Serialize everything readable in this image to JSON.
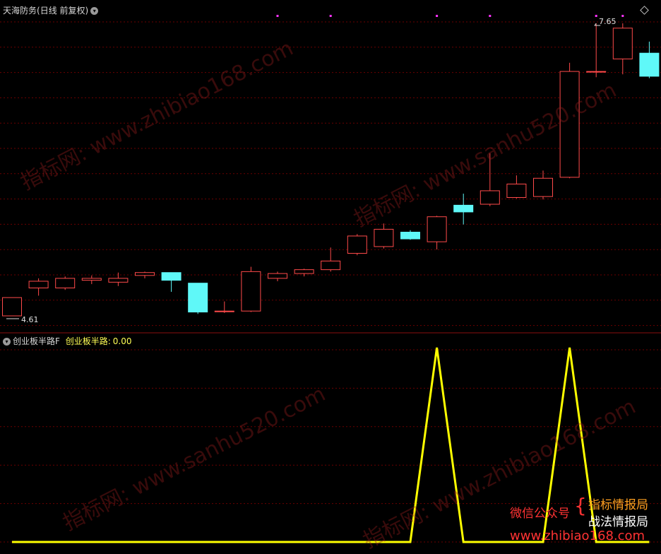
{
  "upper_panel": {
    "title": "天海防务",
    "period": "(日线 前复权)",
    "price_high_label": "7.65",
    "price_low_label": "4.61"
  },
  "lower_panel": {
    "indicator_name": "创业板半路F",
    "indicator_label": "创业板半路:",
    "indicator_value": "0.00"
  },
  "watermarks": {
    "site1": "指标网: www.zhibiao168.com",
    "site2": "指标网: www.sanhu520.com"
  },
  "brand": {
    "wechat": "微信公众号",
    "line1": "指标情报局",
    "line2": "战法情报局",
    "url": "www.zhibiao168.com"
  },
  "colors": {
    "up": "#ff4a4a",
    "down": "#5ff8f8",
    "grid": "#6b0000",
    "indicator": "#ffff00",
    "marker": "#ff33ff"
  },
  "chart_data": [
    {
      "type": "candlestick",
      "title": "天海防务",
      "y_marks": {
        "high": 7.65,
        "low": 4.61
      },
      "candles": [
        {
          "o": 4.61,
          "h": 4.8,
          "l": 4.61,
          "c": 4.8
        },
        {
          "o": 4.9,
          "h": 5.0,
          "l": 4.82,
          "c": 4.97
        },
        {
          "o": 4.9,
          "h": 5.02,
          "l": 4.88,
          "c": 5.0
        },
        {
          "o": 4.98,
          "h": 5.03,
          "l": 4.94,
          "c": 5.0
        },
        {
          "o": 4.96,
          "h": 5.06,
          "l": 4.92,
          "c": 5.0
        },
        {
          "o": 5.03,
          "h": 5.07,
          "l": 5.0,
          "c": 5.06
        },
        {
          "o": 5.06,
          "h": 5.06,
          "l": 4.86,
          "c": 4.98
        },
        {
          "o": 4.95,
          "h": 4.95,
          "l": 4.63,
          "c": 4.65
        },
        {
          "o": 4.66,
          "h": 4.76,
          "l": 4.64,
          "c": 4.66
        },
        {
          "o": 4.66,
          "h": 5.12,
          "l": 4.65,
          "c": 5.07
        },
        {
          "o": 5.0,
          "h": 5.07,
          "l": 4.97,
          "c": 5.05
        },
        {
          "o": 5.05,
          "h": 5.1,
          "l": 5.02,
          "c": 5.09
        },
        {
          "o": 5.09,
          "h": 5.32,
          "l": 5.07,
          "c": 5.18
        },
        {
          "o": 5.26,
          "h": 5.46,
          "l": 5.24,
          "c": 5.44
        },
        {
          "o": 5.33,
          "h": 5.57,
          "l": 5.31,
          "c": 5.51
        },
        {
          "o": 5.48,
          "h": 5.5,
          "l": 5.4,
          "c": 5.41
        },
        {
          "o": 5.38,
          "h": 5.65,
          "l": 5.3,
          "c": 5.64
        },
        {
          "o": 5.76,
          "h": 5.88,
          "l": 5.56,
          "c": 5.69
        },
        {
          "o": 5.77,
          "h": 6.3,
          "l": 5.75,
          "c": 5.91
        },
        {
          "o": 5.84,
          "h": 6.07,
          "l": 5.83,
          "c": 5.98
        },
        {
          "o": 5.85,
          "h": 6.12,
          "l": 5.82,
          "c": 6.04
        },
        {
          "o": 6.05,
          "h": 7.24,
          "l": 6.04,
          "c": 7.15
        },
        {
          "o": 7.15,
          "h": 7.65,
          "l": 7.09,
          "c": 7.15
        },
        {
          "o": 7.28,
          "h": 7.65,
          "l": 7.12,
          "c": 7.6
        },
        {
          "o": 7.34,
          "h": 7.46,
          "l": 7.08,
          "c": 7.1
        }
      ]
    },
    {
      "type": "line",
      "series": [
        {
          "name": "创业板半路",
          "values": [
            0,
            0,
            0,
            0,
            0,
            0,
            0,
            0,
            0,
            0,
            0,
            0,
            0,
            0,
            0,
            0,
            1,
            0,
            0,
            0,
            0,
            1,
            0,
            0,
            0
          ]
        }
      ]
    }
  ]
}
